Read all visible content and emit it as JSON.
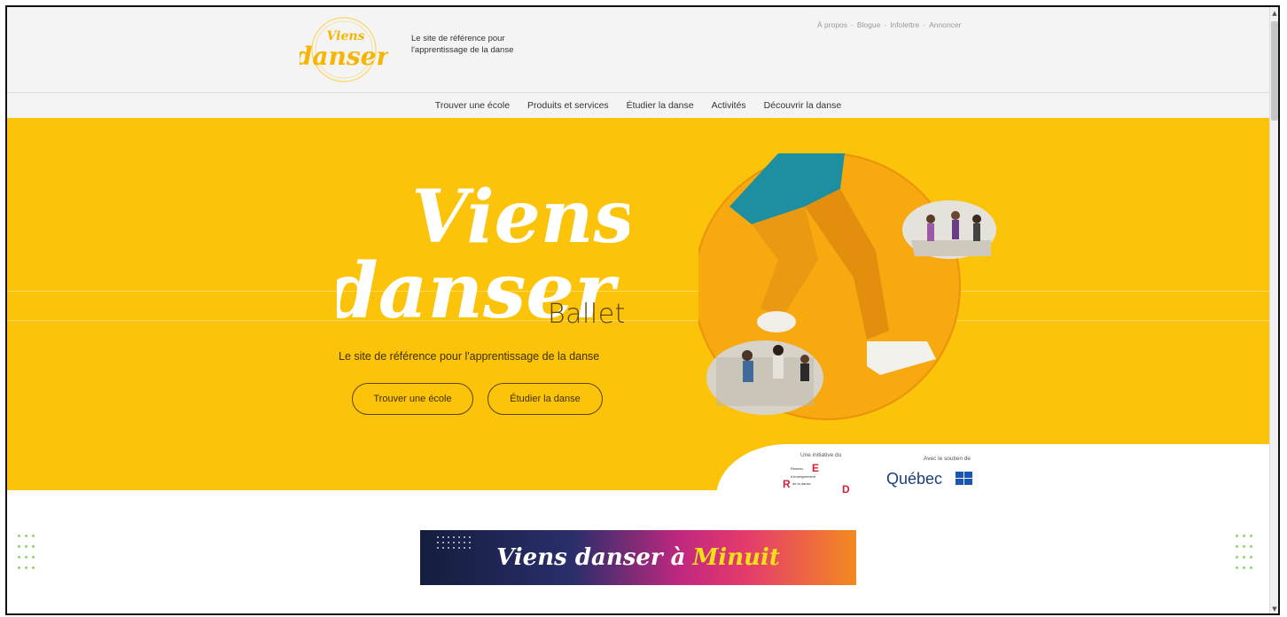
{
  "header": {
    "logo_alt_top": "Viens",
    "logo_alt_bottom": "danser",
    "tagline": "Le site de référence pour l'apprentissage de la danse",
    "util_links": [
      "À propos",
      "Blogue",
      "Infolettre",
      "Annoncer"
    ]
  },
  "nav": {
    "items": [
      "Trouver une école",
      "Produits et services",
      "Étudier la danse",
      "Activités",
      "Découvrir la danse"
    ]
  },
  "hero": {
    "title_line1": "Viens",
    "title_line2": "danser",
    "style": "Ballet",
    "subtitle": "Le site de référence pour l'apprentissage de la danse",
    "button_school": "Trouver une école",
    "button_study": "Étudier la danse"
  },
  "partners": {
    "initiative_label": "Une initiative du",
    "support_label": "Avec le soutien de",
    "red_logo_text": "Réseau d'enseignement de la danse",
    "quebec_logo_text": "Québec"
  },
  "banner": {
    "text_main": "Viens danser à",
    "text_accent": "Minuit"
  },
  "colors": {
    "hero_yellow": "#fbc30a",
    "nav_bg": "#f4f4f4",
    "dot_green": "#8fd46b",
    "red_logo": "#d3213b",
    "quebec_blue": "#1a56b4"
  }
}
